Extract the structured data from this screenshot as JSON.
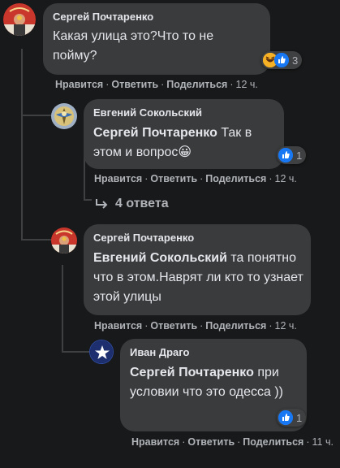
{
  "comments": [
    {
      "author": "Сергей Почтаренко",
      "text": "Какая улица это?Что то не пойму?",
      "reaction_count": "3",
      "actions": {
        "like": "Нравится",
        "reply": "Ответить",
        "share": "Поделиться",
        "time": "12 ч."
      }
    },
    {
      "author": "Евгений Сокольский",
      "mention": "Сергей Почтаренко",
      "text": "Так в этом и вопрос😀",
      "reaction_count": "1",
      "actions": {
        "like": "Нравится",
        "reply": "Ответить",
        "share": "Поделиться",
        "time": "12 ч."
      }
    },
    {
      "author": "Сергей Почтаренко",
      "mention": "Евгений Сокольский",
      "text": "та понятно что в этом.Наврят ли кто то узнает этой улицы",
      "actions": {
        "like": "Нравится",
        "reply": "Ответить",
        "share": "Поделиться",
        "time": "12 ч."
      }
    },
    {
      "author": "Иван Драго",
      "mention": "Сергей Почтаренко",
      "text": "при условии что это одесса ))",
      "reaction_count": "1",
      "actions": {
        "like": "Нравится",
        "reply": "Ответить",
        "share": "Поделиться",
        "time": "11 ч."
      }
    }
  ],
  "replies_link": "4 ответа"
}
